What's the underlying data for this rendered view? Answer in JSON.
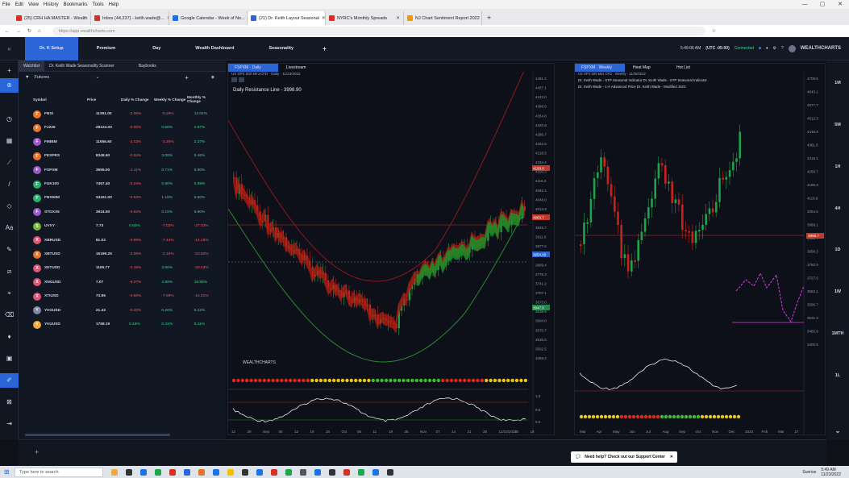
{
  "menubar": {
    "items": [
      "File",
      "Edit",
      "View",
      "History",
      "Bookmarks",
      "Tools",
      "Help"
    ]
  },
  "browser": {
    "tabs": [
      {
        "label": "(25) CRH HA MASTER - Wealth",
        "color": "#d93025"
      },
      {
        "label": "Inbox (44,237) - keith.wade@...",
        "color": "#d93025"
      },
      {
        "label": "Google Calendar - Week of No...",
        "color": "#1a73e8"
      },
      {
        "label": "(21) Dr. Keith Layout Seasonal",
        "color": "#2a66d8"
      },
      {
        "label": "NYRC's Monthly Spreads",
        "color": "#d93025"
      },
      {
        "label": "NJ Chart Sentiment Report 2022",
        "color": "#f29900"
      }
    ],
    "url": "https://app.wealthcharts.com"
  },
  "topnav": {
    "buttons": [
      "Dr. K Setup",
      "Premium",
      "Day",
      "Wealth Dashboard",
      "Seasonality"
    ],
    "time": "5:49:06 AM",
    "tz": "(UTC -05:00)",
    "status": "Connected",
    "brand": "WEALTHCHARTS"
  },
  "watchlist": {
    "tabs": [
      "Watchlist",
      "Dr. Keith Wade Seasonality Scanner",
      "Baybooks"
    ],
    "filter": "Futures",
    "headers": [
      "Symbol",
      "Price",
      "Daily % Change",
      "Weekly % Change",
      "Monthly % Change"
    ],
    "rows": [
      {
        "l": "F",
        "sym": "FNSI",
        "price": "11361.00",
        "d": "-2.06%",
        "w": "-5.29%",
        "m": "13.04%",
        "color": "#e8742c"
      },
      {
        "l": "F",
        "sym": "FJ225",
        "price": "28124.00",
        "d": "-0.90%",
        "w": "0.58%",
        "m": "2.97%",
        "color": "#e8742c"
      },
      {
        "l": "F",
        "sym": "FMIBM",
        "price": "11656.60",
        "d": "-2.03%",
        "w": "-3.26%",
        "m": "2.37%",
        "color": "#9b59c8"
      },
      {
        "l": "F",
        "sym": "FESPRS",
        "price": "8348.60",
        "d": "-0.54%",
        "w": "3.08%",
        "m": "5.46%",
        "color": "#e8742c"
      },
      {
        "l": "F",
        "sym": "FSPXM",
        "price": "3955.00",
        "d": "-1.11%",
        "w": "0.71%",
        "m": "5.90%",
        "color": "#9b59c8"
      },
      {
        "l": "F",
        "sym": "FUK100",
        "price": "7467.40",
        "d": "-0.04%",
        "w": "0.90%",
        "m": "5.99%",
        "color": "#2fae6f"
      },
      {
        "l": "F",
        "sym": "FNS50M",
        "price": "34161.00",
        "d": "-0.83%",
        "w": "1.18%",
        "m": "5.60%",
        "color": "#2fae6f"
      },
      {
        "l": "F",
        "sym": "STOXX5",
        "price": "3924.50",
        "d": "-0.82%",
        "w": "0.15%",
        "m": "5.90%",
        "color": "#9b59c8"
      },
      {
        "l": "S",
        "sym": "UVXY",
        "price": "7.73",
        "d": "0.63%",
        "w": "-7.03%",
        "m": "-27.03%",
        "color": "#7bb43a"
      },
      {
        "l": "X",
        "sym": "XBRUSD",
        "price": "81.03",
        "d": "-0.99%",
        "w": "-7.44%",
        "m": "-14.19%",
        "color": "#e05576"
      },
      {
        "l": "X",
        "sym": "XBTUSD",
        "price": "16199.25",
        "d": "-2.06%",
        "w": "-2.34%",
        "m": "-23.60%",
        "color": "#e8742c"
      },
      {
        "l": "X",
        "sym": "XETUSD",
        "price": "1165.77",
        "d": "-2.15%",
        "w": "3.56%",
        "m": "-33.43%",
        "color": "#e05576"
      },
      {
        "l": "X",
        "sym": "XNGUSD",
        "price": "7.07",
        "d": "-6.07%",
        "w": "4.99%",
        "m": "19.56%",
        "color": "#e05576"
      },
      {
        "l": "X",
        "sym": "XTIUSD",
        "price": "73.86",
        "d": "-0.50%",
        "w": "-7.59%",
        "m": "-16.21%",
        "color": "#e05576"
      },
      {
        "l": "Y",
        "sym": "YAGUSD",
        "price": "21.43",
        "d": "-0.20%",
        "w": "0.26%",
        "m": "5.22%",
        "color": "#7a8aa8"
      },
      {
        "l": "Y",
        "sym": "YAUUSD",
        "price": "1758.19",
        "d": "0.16%",
        "w": "0.41%",
        "m": "5.11%",
        "color": "#f2a93b"
      }
    ]
  },
  "chartA": {
    "tabs": [
      "FSPXM · Daily",
      "Livestream"
    ],
    "symbol_line": "US SPX 500 Mini CFD · Daily · 11/23/2022",
    "resistance_label": "Daily Resistance Line - 3998.90",
    "price_axis": [
      "4481.2",
      "4457.1",
      "4423.0",
      "4388.9",
      "4354.8",
      "4320.8",
      "4286.7",
      "4252.6",
      "4218.5",
      "4184.4",
      "4150.3",
      "4116.2",
      "4082.1",
      "4048.0",
      "4013.9",
      "3979.8",
      "3945.7",
      "3911.6",
      "3877.6",
      "3843.5",
      "3809.4",
      "3775.3",
      "3741.2",
      "3707.1",
      "3673.0",
      "3638.9",
      "3604.8",
      "3570.7",
      "3536.6",
      "3502.5",
      "3468.4"
    ],
    "tags": [
      {
        "v": "4150.0",
        "c": "#c0392b"
      },
      {
        "v": "3963.7",
        "c": "#c0392b"
      },
      {
        "v": "3954.00",
        "c": "#2a66d8"
      },
      {
        "v": "3947.0",
        "c": "#1f8a4c"
      }
    ],
    "date_axis": [
      "12",
      "29",
      "Sep",
      "06",
      "12",
      "19",
      "26",
      "Oct",
      "06",
      "11",
      "19",
      "25",
      "Nov",
      "07",
      "14",
      "21",
      "28",
      "12/23/2022",
      "10",
      "18"
    ],
    "sub_label": "WEALTHCHARTS",
    "sub_axis": [
      "1.0",
      "0.5",
      "0.0"
    ]
  },
  "chartB": {
    "tabs": [
      "FSPXM · Weekly",
      "Heat Map",
      "Hot List"
    ],
    "symbol_line": "US SPX 500 Mini CFD · Weekly · 11/25/2022",
    "legend1": "Dr. Keith Wade - STP Seasonal Indicator   Dr. Keith Wade - STP Seasonal Indicator",
    "legend2": "Dr. Keith Wade - 1-A Advanced Price   Dr. Keith Wade - Modified JSGI",
    "price_axis": [
      "4708.5",
      "4643.1",
      "4577.7",
      "4512.3",
      "4446.9",
      "4381.5",
      "4316.1",
      "4250.7",
      "4185.3",
      "4119.9",
      "4054.5",
      "3989.1",
      "3923.7",
      "3858.3",
      "3792.9",
      "3727.5",
      "3662.1",
      "3596.7",
      "3531.3",
      "3465.9",
      "3400.5"
    ],
    "tag": "3998.7",
    "date_axis": [
      "Mar",
      "Apr",
      "May",
      "Jun",
      "Jul",
      "Aug",
      "Sep",
      "Oct",
      "Nov",
      "Dec",
      "2023",
      "Feb",
      "Mar",
      "27"
    ]
  },
  "rightrail": [
    "1M",
    "5M",
    "1H",
    "4H",
    "1D",
    "1W",
    "1MTH",
    "1L"
  ],
  "help": "Need help? Check out our Support Center",
  "taskbar": {
    "search": "Type here to search",
    "weather": "Sunrise",
    "time": "5:49 AM",
    "date": "11/23/2022"
  },
  "colors": {
    "accent": "#2a66d8",
    "up": "#1fa24a",
    "down": "#c8231b",
    "bg": "#0d1019"
  }
}
